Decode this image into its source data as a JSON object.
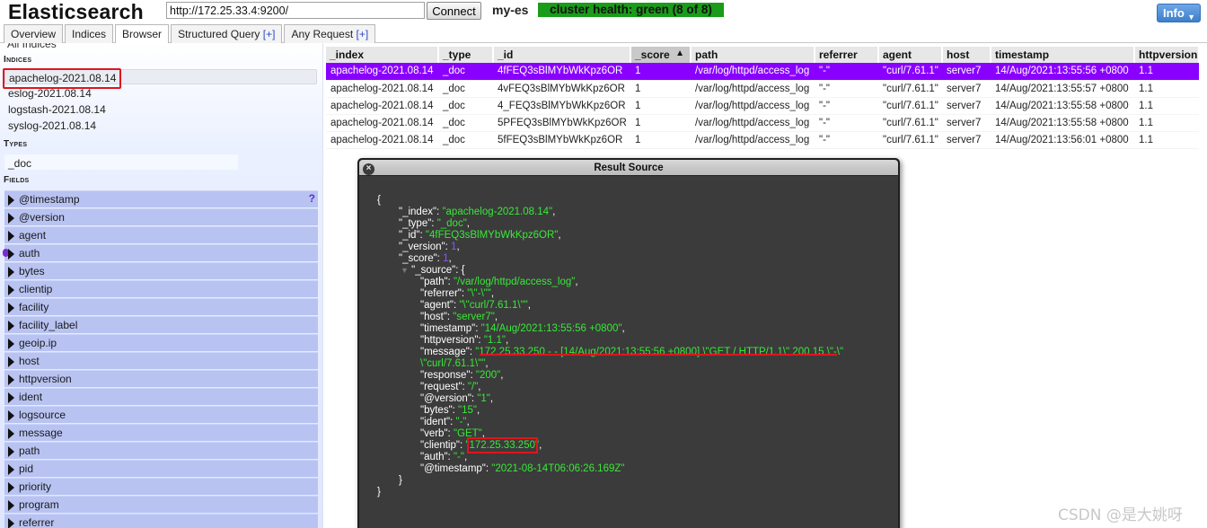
{
  "header": {
    "brand": "Elasticsearch",
    "url": "http://172.25.33.4:9200/",
    "connect_label": "Connect",
    "cluster_name": "my-es",
    "cluster_health": "cluster health: green (8 of 8)",
    "info_label": "Info",
    "colors": {
      "health": "#1a9c1a",
      "info": "#3d7fcb",
      "selected_row": "#8a00ff"
    }
  },
  "tabs": [
    {
      "label": "Overview",
      "plus": ""
    },
    {
      "label": "Indices",
      "plus": ""
    },
    {
      "label": "Browser",
      "plus": "",
      "active": true
    },
    {
      "label": "Structured Query ",
      "plus": "[+]"
    },
    {
      "label": "Any Request ",
      "plus": "[+]"
    }
  ],
  "sidebar": {
    "all_indices": "All Indices",
    "indices_title": "Indices",
    "indices": [
      "apachelog-2021.08.14",
      "eslog-2021.08.14",
      "logstash-2021.08.14",
      "syslog-2021.08.14"
    ],
    "types_title": "Types",
    "types": [
      "_doc"
    ],
    "fields_title": "Fields",
    "fields": [
      "@timestamp",
      "@version",
      "agent",
      "auth",
      "bytes",
      "clientip",
      "facility",
      "facility_label",
      "geoip.ip",
      "host",
      "httpversion",
      "ident",
      "logsource",
      "message",
      "path",
      "pid",
      "priority",
      "program",
      "referrer"
    ],
    "help_mark": "?"
  },
  "results": {
    "columns": [
      "_index",
      "_type",
      "_id",
      "_score",
      "path",
      "referrer",
      "agent",
      "host",
      "timestamp",
      "httpversion"
    ],
    "sort_indicator": "▲",
    "rows": [
      [
        "apachelog-2021.08.14",
        "_doc",
        "4fFEQ3sBlMYbWkKpz6OR",
        "1",
        "/var/log/httpd/access_log",
        "\"-\"",
        "\"curl/7.61.1\"",
        "server7",
        "14/Aug/2021:13:55:56 +0800",
        "1.1"
      ],
      [
        "apachelog-2021.08.14",
        "_doc",
        "4vFEQ3sBlMYbWkKpz6OR",
        "1",
        "/var/log/httpd/access_log",
        "\"-\"",
        "\"curl/7.61.1\"",
        "server7",
        "14/Aug/2021:13:55:57 +0800",
        "1.1"
      ],
      [
        "apachelog-2021.08.14",
        "_doc",
        "4_FEQ3sBlMYbWkKpz6OR",
        "1",
        "/var/log/httpd/access_log",
        "\"-\"",
        "\"curl/7.61.1\"",
        "server7",
        "14/Aug/2021:13:55:58 +0800",
        "1.1"
      ],
      [
        "apachelog-2021.08.14",
        "_doc",
        "5PFEQ3sBlMYbWkKpz6OR",
        "1",
        "/var/log/httpd/access_log",
        "\"-\"",
        "\"curl/7.61.1\"",
        "server7",
        "14/Aug/2021:13:55:58 +0800",
        "1.1"
      ],
      [
        "apachelog-2021.08.14",
        "_doc",
        "5fFEQ3sBlMYbWkKpz6OR",
        "1",
        "/var/log/httpd/access_log",
        "\"-\"",
        "\"curl/7.61.1\"",
        "server7",
        "14/Aug/2021:13:56:01 +0800",
        "1.1"
      ]
    ]
  },
  "dialog": {
    "title": "Result Source",
    "close": "×",
    "lines": [
      {
        "key": "{"
      },
      {
        "key": "\"_index\": ",
        "val": "\"apachelog-2021.08.14\"",
        "tail": ","
      },
      {
        "key": "\"_type\": ",
        "val": "\"_doc\"",
        "tail": ","
      },
      {
        "key": "\"_id\": ",
        "val": "\"4fFEQ3sBlMYbWkKpz6OR\"",
        "tail": ","
      },
      {
        "key": "\"_version\": ",
        "num": "1",
        "tail": ","
      },
      {
        "key": "\"_score\": ",
        "num": "1",
        "tail": ","
      },
      {
        "key": "\"_source\": {"
      },
      {
        "key": "\"path\": ",
        "val": "\"/var/log/httpd/access_log\"",
        "tail": ","
      },
      {
        "key": "\"referrer\": ",
        "val": "\"\\\"-\\\"\"",
        "tail": ","
      },
      {
        "key": "\"agent\": ",
        "val": "\"\\\"curl/7.61.1\\\"\"",
        "tail": ","
      },
      {
        "key": "\"host\": ",
        "val": "\"server7\"",
        "tail": ","
      },
      {
        "key": "\"timestamp\": ",
        "val": "\"14/Aug/2021:13:55:56 +0800\"",
        "tail": ","
      },
      {
        "key": "\"httpversion\": ",
        "val": "\"1.1\"",
        "tail": ","
      },
      {
        "key": "\"message\": ",
        "val": "\"172.25.33.250 - - [14/Aug/2021:13:55:56 +0800] \\\"GET / HTTP/1.1\\\" 200 15 \\\"-\\\""
      },
      {
        "key": "",
        "val": "\\\"curl/7.61.1\\\"\"",
        "tail": ","
      },
      {
        "key": "\"response\": ",
        "val": "\"200\"",
        "tail": ","
      },
      {
        "key": "\"request\": ",
        "val": "\"/\"",
        "tail": ","
      },
      {
        "key": "\"@version\": ",
        "val": "\"1\"",
        "tail": ","
      },
      {
        "key": "\"bytes\": ",
        "val": "\"15\"",
        "tail": ","
      },
      {
        "key": "\"ident\": ",
        "val": "\"-\"",
        "tail": ","
      },
      {
        "key": "\"verb\": ",
        "val": "\"GET\"",
        "tail": ","
      },
      {
        "key": "\"clientip\": ",
        "val": "\"172.25.33.250\"",
        "tail": ","
      },
      {
        "key": "\"auth\": ",
        "val": "\"-\"",
        "tail": ","
      },
      {
        "key": "\"@timestamp\": ",
        "val": "\"2021-08-14T06:06:26.169Z\""
      },
      {
        "key": "}"
      },
      {
        "key": "}"
      }
    ],
    "collapse_arrow": "▼"
  },
  "watermark": "CSDN @是大姚呀"
}
